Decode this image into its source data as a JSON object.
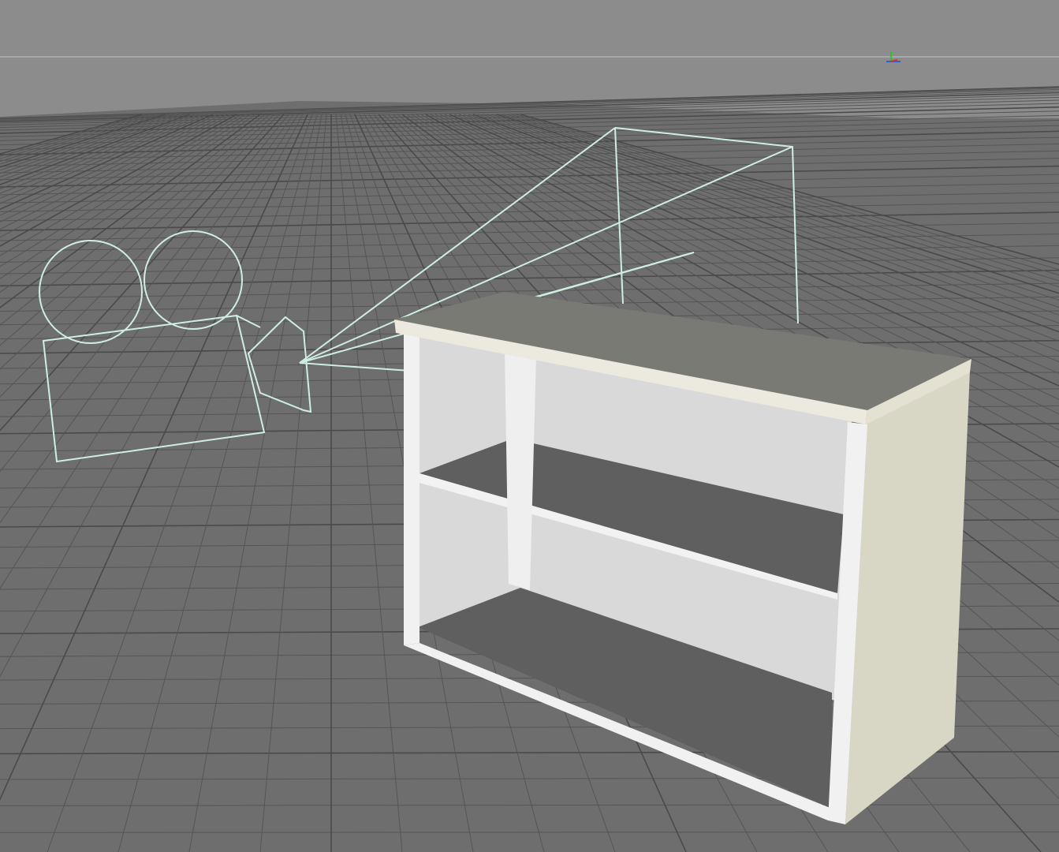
{
  "viewport": {
    "background_sky": "#8c8c8c",
    "horizon_line_color": "#a8a8a8",
    "floor_color": "#6e6e6e",
    "grid_color": "#555555",
    "grid_major_color": "#4a4a4a"
  },
  "axis_gizmo": {
    "icon": "world-axis-icon",
    "colors": {
      "x": "#d03030",
      "y": "#30c030",
      "z": "#3060d0"
    }
  },
  "camera": {
    "icon": "camera-wireframe-icon",
    "wire_color": "#cfeee2"
  },
  "shelf": {
    "icon": "shelf-object",
    "top_color": "#7a7a74",
    "edge_color": "#ece9de",
    "side_color": "#d8d6c4",
    "panel_color": "#d9d9d9",
    "frame_color": "#f1f1f1",
    "shelf_board_color": "#5f5f5f"
  }
}
